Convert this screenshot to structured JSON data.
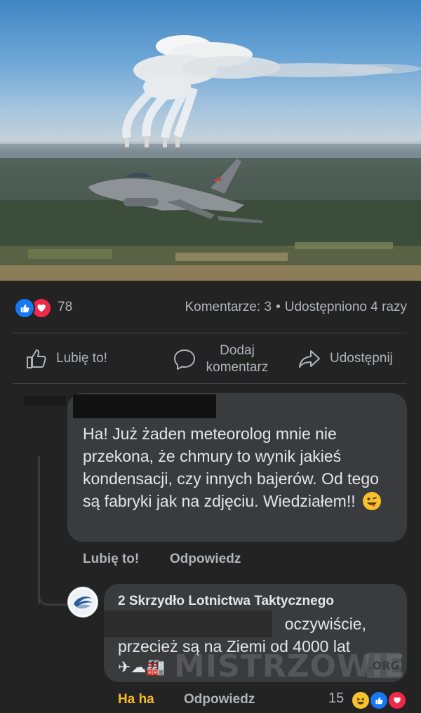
{
  "post": {
    "image_alt": "F-16 fighter jet over landscape with power plant cooling towers emitting clouds",
    "reaction_count": "78",
    "comments_label": "Komentarze: 3",
    "shares_label": "Udostępniono 4 razy",
    "separator": "•"
  },
  "actions": {
    "like_label": "Lubię to!",
    "comment_label_line1": "Dodaj",
    "comment_label_line2": "komentarz",
    "share_label": "Udostępnij"
  },
  "comments": [
    {
      "text": "Ha! Już żaden meteorolog mnie nie przekona, że chmury to wynik jakieś kondensacji, czy innych bajerów. Od tego są fabryki jak na zdjęciu. Wiedziałem!!",
      "like_label": "Lubię to!",
      "reply_label": "Odpowiedz"
    },
    {
      "author": "2 Skrzydło Lotnictwa Taktycznego",
      "text_line1": "oczywiście,",
      "text_line2": "przecież są na Ziemi od 4000 lat",
      "emoji_line": "✈☁🏭",
      "reaction_label": "Ha ha",
      "reply_label": "Odpowiedz",
      "reaction_count": "15"
    }
  ],
  "watermark": {
    "text": "MISTRZOWIE",
    "suffix": ".ORG"
  },
  "colors": {
    "background": "#232324",
    "bubble": "#3a3b3c",
    "like_blue": "#1877f2",
    "love_red": "#f02849",
    "haha_yellow": "#f7b928"
  },
  "icons": [
    "like-reaction-icon",
    "love-reaction-icon",
    "thumbs-up-icon",
    "comment-icon",
    "share-icon",
    "haha-reaction-icon",
    "wink-emoji-icon",
    "avatar-logo-icon"
  ]
}
